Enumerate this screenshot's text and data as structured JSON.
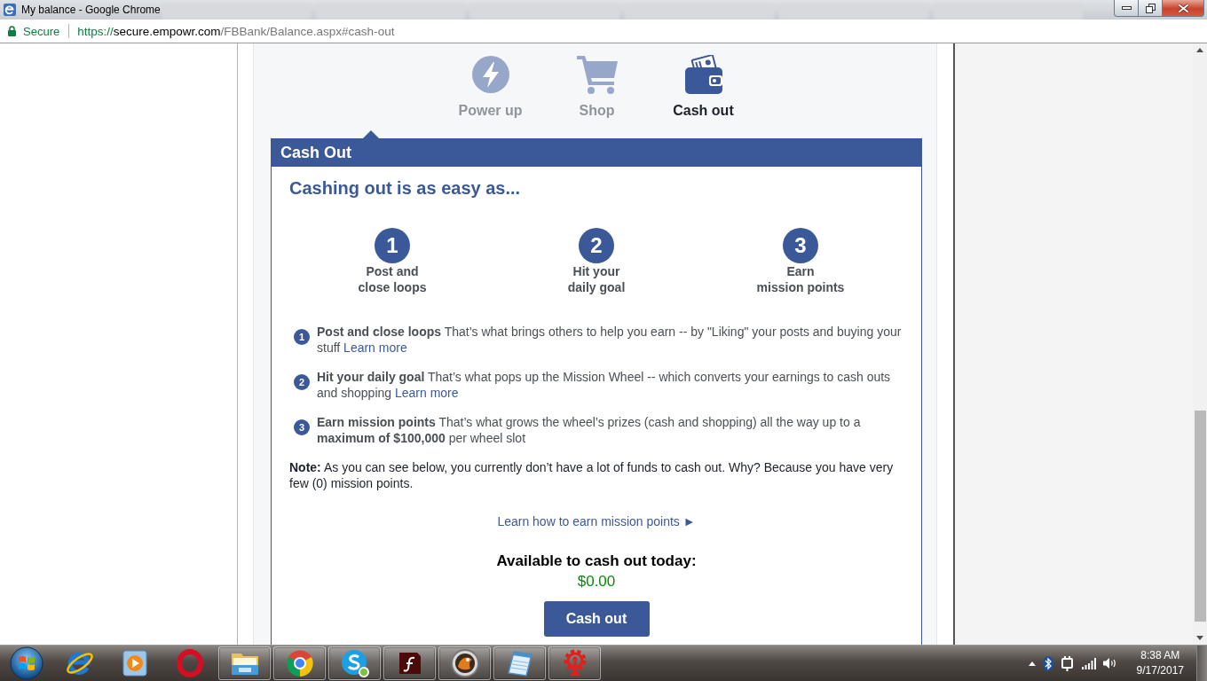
{
  "window": {
    "title": "My balance - Google Chrome"
  },
  "address_bar": {
    "security": "Secure",
    "url": {
      "scheme": "https://",
      "host": "secure.empowr.com",
      "path": "/FBBank/Balance.aspx#cash-out"
    }
  },
  "nav": [
    {
      "label": "Power up",
      "kind": "bolt",
      "selected": false
    },
    {
      "label": "Shop",
      "kind": "cart",
      "selected": false
    },
    {
      "label": "Cash out",
      "kind": "wallet",
      "selected": true
    }
  ],
  "panel": {
    "title": "Cash Out",
    "heading": "Cashing out is as easy as...",
    "steps": [
      {
        "number": "1",
        "label_lines": [
          "Post and",
          "close loops"
        ]
      },
      {
        "number": "2",
        "label_lines": [
          "Hit your",
          "daily goal"
        ]
      },
      {
        "number": "3",
        "label_lines": [
          "Earn",
          "mission points"
        ]
      }
    ],
    "details": [
      {
        "number": "1",
        "text": "**Post and close loops** That’s what brings others to help you earn -- by \"Liking\" your posts and buying your stuff",
        "link": "Learn more"
      },
      {
        "number": "2",
        "text": "**Hit your daily goal** That’s what pops up the Mission Wheel -- which converts your earnings to cash outs and shopping",
        "link": "Learn more"
      },
      {
        "number": "3",
        "text": "**Earn mission points** That’s what grows the wheel’s prizes (cash and shopping) all the way up to a **maximum of $100,000** per wheel slot"
      }
    ],
    "note": "**Note:** As you can see below, you currently don’t have a lot of funds to cash out. Why? Because you have very few (0) mission points.",
    "earn_link": "Learn how to earn mission points ►",
    "available_label": "Available to cash out today:",
    "amount": "$0.00",
    "button": "Cash out"
  },
  "taskbar": {
    "apps": [
      {
        "kind": "eglobe",
        "running": false
      },
      {
        "kind": "player",
        "running": false
      },
      {
        "kind": "ring",
        "running": false
      },
      {
        "kind": "folder",
        "running": true
      },
      {
        "kind": "wheel",
        "running": true
      },
      {
        "kind": "sbubble",
        "running": true
      },
      {
        "kind": "ftile",
        "running": true
      },
      {
        "kind": "badge",
        "running": true
      },
      {
        "kind": "notepad",
        "running": true
      },
      {
        "kind": "gear",
        "running": true
      }
    ],
    "clock": {
      "time": "8:38 AM",
      "date": "9/17/2017"
    }
  }
}
